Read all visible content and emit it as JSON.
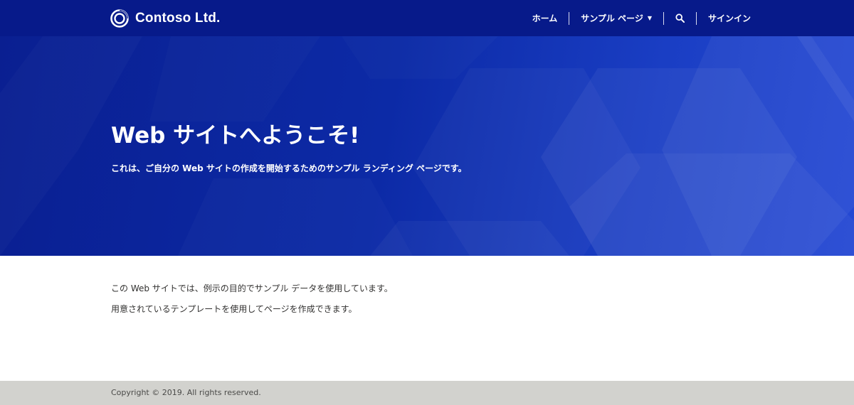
{
  "brand": {
    "name": "Contoso Ltd.",
    "icon": "ring-logo-icon"
  },
  "nav": {
    "home": "ホーム",
    "sample_pages": "サンプル ページ",
    "search_icon": "search-icon",
    "signin": "サインイン"
  },
  "hero": {
    "title": "Web サイトへようこそ!",
    "subtitle": "これは、ご自分の Web サイトの作成を開始するためのサンプル ランディング ページです。"
  },
  "main": {
    "paragraphs": [
      "この Web サイトでは、例示の目的でサンプル データを使用しています。",
      "用意されているテンプレートを使用してページを作成できます。"
    ]
  },
  "footer": {
    "copyright": "Copyright © 2019. All rights reserved."
  },
  "colors": {
    "header_bg": "#071a8a",
    "hero_start": "#0a1f91",
    "hero_end": "#2549d4",
    "footer_bg": "#d2d2ce"
  }
}
